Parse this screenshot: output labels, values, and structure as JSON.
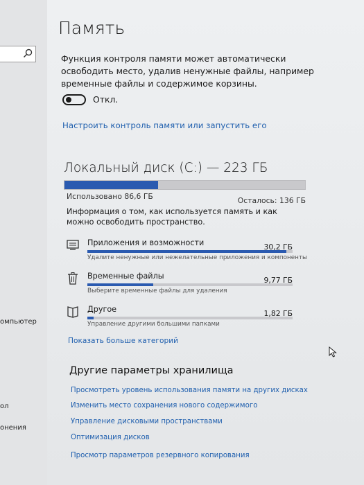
{
  "sidebar": {
    "search_placeholder": "",
    "items": [
      {
        "label": "омпьютер"
      },
      {
        "label": "ол"
      },
      {
        "label": "онения"
      }
    ]
  },
  "page": {
    "title": "Память",
    "description": "Функция контроля памяти может автоматически освободить место, удалив ненужные файлы, например временные файлы и содержимое корзины.",
    "toggle_state_label": "Откл.",
    "configure_link": "Настроить контроль памяти или запустить его"
  },
  "disk": {
    "title": "Локальный диск (C:) — 223 ГБ",
    "used_label": "Использовано 86,6 ГБ",
    "free_label": "Осталось: 136 ГБ",
    "used_fraction": 0.388,
    "info_text": "Информация о том, как используется память и как можно освободить пространство."
  },
  "categories": [
    {
      "name": "Приложения и возможности",
      "size": "30,2 ГБ",
      "subtitle": "Удалите ненужные или нежелательные приложения и компоненты",
      "fill_fraction": 0.97,
      "icon": "apps-icon"
    },
    {
      "name": "Временные файлы",
      "size": "9,77 ГБ",
      "subtitle": "Выберите временные файлы для удаления",
      "fill_fraction": 0.32,
      "icon": "trash-icon"
    },
    {
      "name": "Другое",
      "size": "1,82 ГБ",
      "subtitle": "Управление другими большими папками",
      "fill_fraction": 0.03,
      "icon": "folder-icon"
    }
  ],
  "more_categories_link": "Показать больше категорий",
  "other_settings": {
    "title": "Другие параметры хранилища",
    "links": [
      "Просмотреть уровень использования памяти на других дисках",
      "Изменить место сохранения нового содержимого",
      "Управление дисковыми пространствами",
      "Оптимизация дисков",
      "Просмотр параметров резервного копирования"
    ]
  },
  "colors": {
    "accent": "#2a5ab0",
    "link": "#1f5fae",
    "bar_background": "#c9c9cc"
  }
}
